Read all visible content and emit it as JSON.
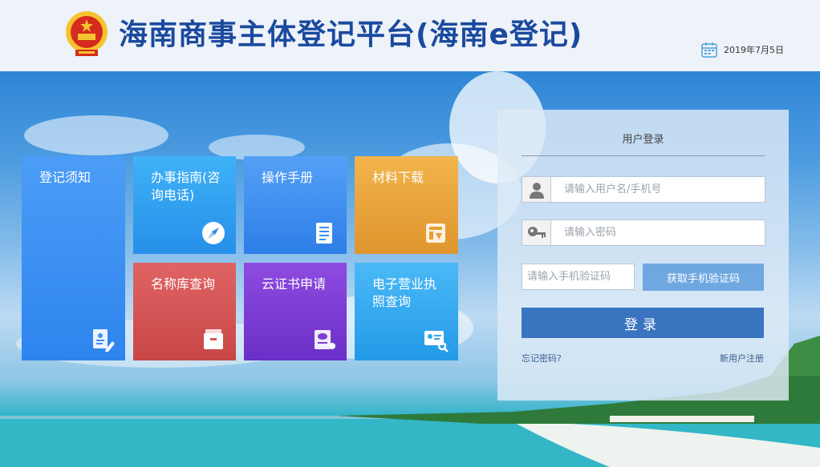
{
  "header": {
    "title": "海南商事主体登记平台(海南e登记)",
    "date": "2019年7月5日",
    "emblem_icon": "national-emblem-icon",
    "calendar_icon": "calendar-icon"
  },
  "tiles": [
    {
      "label": "登记须知",
      "icon": "document-edit-icon",
      "color": "#3f8ff5"
    },
    {
      "label": "办事指南(咨询电话)",
      "icon": "compass-icon",
      "color": "#2e9ef0"
    },
    {
      "label": "操作手册",
      "icon": "manual-icon",
      "color": "#3a8ff2"
    },
    {
      "label": "材料下载",
      "icon": "download-box-icon",
      "color": "#eaa23a"
    },
    {
      "label": "名称库查询",
      "icon": "archive-box-icon",
      "color": "#d65656"
    },
    {
      "label": "云证书申请",
      "icon": "cloud-certificate-icon",
      "color": "#7c3fd1"
    },
    {
      "label": "电子营业执照查询",
      "icon": "license-search-icon",
      "color": "#2fa9ee"
    }
  ],
  "login": {
    "title": "用户登录",
    "username_placeholder": "请输入用户名/手机号",
    "password_placeholder": "请输入密码",
    "code_placeholder": "请输入手机验证码",
    "get_code_label": "获取手机验证码",
    "submit_label": "登录",
    "forgot_label": "忘记密码?",
    "register_label": "新用户注册",
    "user_icon": "user-icon",
    "key_icon": "key-icon"
  },
  "colors": {
    "title": "#1a4a9e",
    "login_button": "#3a74c0",
    "code_button": "#6fa8e0"
  }
}
